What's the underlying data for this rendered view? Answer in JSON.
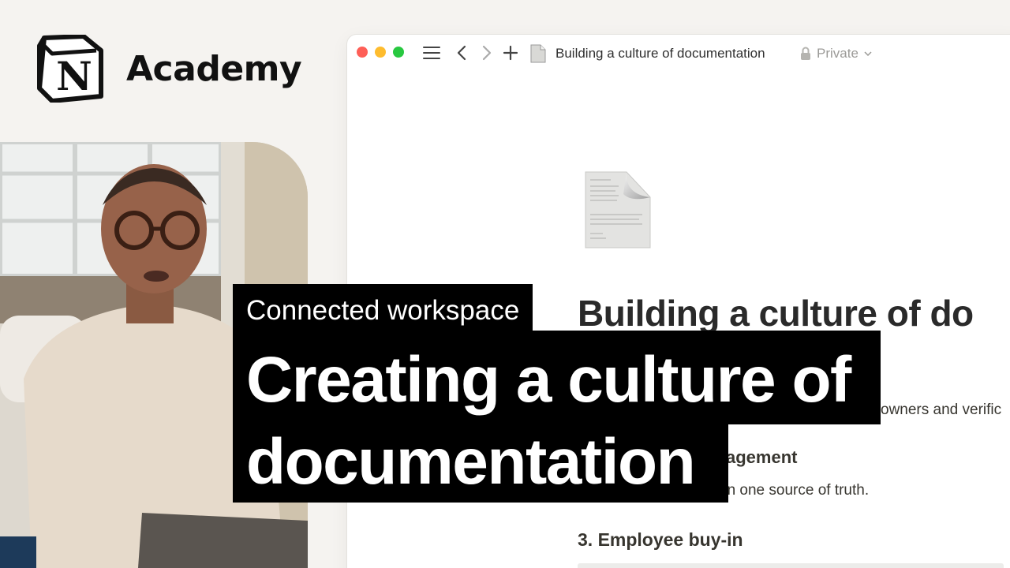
{
  "brand": {
    "name": "Academy",
    "logo_icon": "notion-logo-icon",
    "logo_letter": "N"
  },
  "presenter": {
    "description_icon": "presenter-video"
  },
  "window": {
    "controls": [
      "close",
      "minimize",
      "zoom"
    ],
    "toolbar_icons": [
      "sidebar-menu-icon",
      "back-arrow-icon",
      "forward-arrow-icon",
      "new-page-plus-icon"
    ],
    "page_title": "Building a culture of documentation",
    "privacy": "Private",
    "page_icon": "document-page-icon",
    "heading": "Building a culture of do",
    "body_fragment_1": "owners and verific",
    "subheading_fragment": "agement",
    "body_fragment_2": "on one source of truth.",
    "section_heading": "3. Employee buy-in"
  },
  "caption": {
    "kicker": "Connected workspace",
    "title_line_1": "Creating a culture of",
    "title_line_2": "documentation"
  },
  "colors": {
    "traffic_red": "#fe5f57",
    "traffic_yellow": "#febc2e",
    "traffic_green": "#28c840",
    "caption_bg": "#000000",
    "page_bg": "#f5f3f0"
  }
}
